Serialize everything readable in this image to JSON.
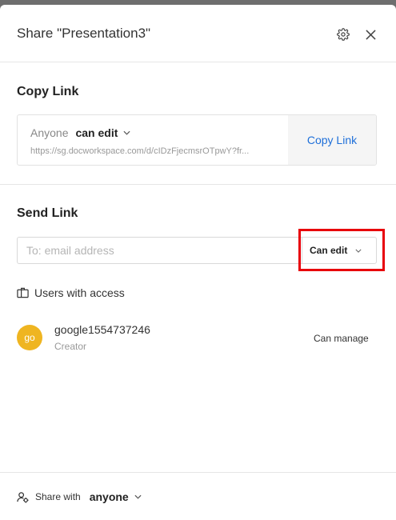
{
  "dialog": {
    "title": "Share \"Presentation3\""
  },
  "copy_link": {
    "section_title": "Copy Link",
    "audience": "Anyone",
    "permission": "can edit",
    "url": "https://sg.docworkspace.com/d/cIDzFjecmsrOTpwY?fr...",
    "button_label": "Copy Link"
  },
  "send_link": {
    "section_title": "Send Link",
    "email_placeholder": "To: email address",
    "email_value": "",
    "permission": "Can edit"
  },
  "users": {
    "label": "Users with access",
    "items": [
      {
        "avatar_text": "go",
        "avatar_color": "#efb521",
        "name": "google1554737246",
        "role": "Creator",
        "access": "Can manage"
      }
    ]
  },
  "footer": {
    "share_with_label": "Share with",
    "share_with_value": "anyone"
  },
  "colors": {
    "accent": "#1e6fd9",
    "highlight": "#e8000b"
  },
  "icons": {
    "settings": "gear-icon",
    "close": "close-icon",
    "chevron": "chevron-down-icon",
    "users": "users-book-icon",
    "share": "share-users-icon"
  }
}
